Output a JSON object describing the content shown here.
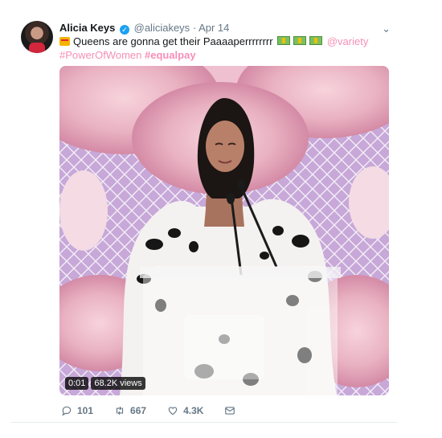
{
  "tweet": {
    "name": "Alicia Keys",
    "handle": "@aliciakeys",
    "separator": "·",
    "date": "Apr 14",
    "text_main": "Queens are gonna get their Paaaaperrrrrrrr",
    "mention": "@variety",
    "hashtag1": "#PowerOfWomen",
    "hashtag2": "#equalpay"
  },
  "media": {
    "time": "0:01",
    "views": "68.2K views"
  },
  "actions": {
    "replies": "101",
    "retweets": "667",
    "likes": "4.3K"
  },
  "colors": {
    "link": "#f78fb6",
    "muted": "#657786",
    "verified": "#1da1f2"
  },
  "icons": [
    "crown-emoji",
    "money-emoji",
    "verified-icon",
    "chevron-down-icon",
    "reply-icon",
    "retweet-icon",
    "like-icon",
    "dm-icon"
  ]
}
